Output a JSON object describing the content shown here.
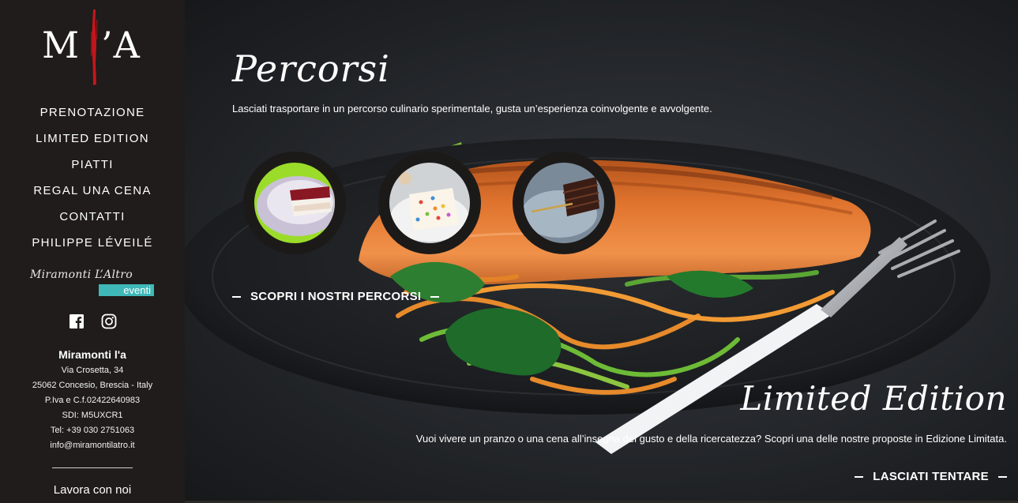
{
  "brand": {
    "logo_text_left": "M",
    "logo_text_right": "’A",
    "accent_color": "#c4161c"
  },
  "nav": {
    "items": [
      {
        "label": "PRENOTAZIONE"
      },
      {
        "label": "LIMITED EDITION"
      },
      {
        "label": "PIATTI"
      },
      {
        "label": "REGAL UNA CENA"
      },
      {
        "label": "CONTATTI"
      },
      {
        "label": "PHILIPPE LÉVEILÉ"
      }
    ]
  },
  "eventi": {
    "brand": "Miramonti L’Altro",
    "tag": "eventi",
    "tag_color": "#3fb8b8"
  },
  "social": {
    "icons": [
      "facebook-icon",
      "instagram-icon"
    ]
  },
  "address": {
    "name": "Miramonti l'a",
    "street": "Via Crosetta, 34",
    "city": "25062 Concesio, Brescia - Italy",
    "vat": "P.Iva e C.f.02422640983",
    "sdi": "SDI: M5UXCR1",
    "tel": "Tel: +39 030 2751063",
    "email": "info@miramontilatro.it"
  },
  "footer_link": "Lavora con noi",
  "percorsi": {
    "title": "Percorsi",
    "description": "Lasciati trasportare in un percorso culinario sperimentale, gusta un’esperienza coinvolgente e avvolgente.",
    "cta": "SCOPRI I NOSTRI PERCORSI"
  },
  "limited": {
    "title": "Limited Edition",
    "description": "Vuoi vivere un pranzo o una cena all’insegna del gusto e della ricercatezza? Scopri una delle nostre proposte in Edizione Limitata.",
    "cta": "LASCIATI TENTARE"
  }
}
